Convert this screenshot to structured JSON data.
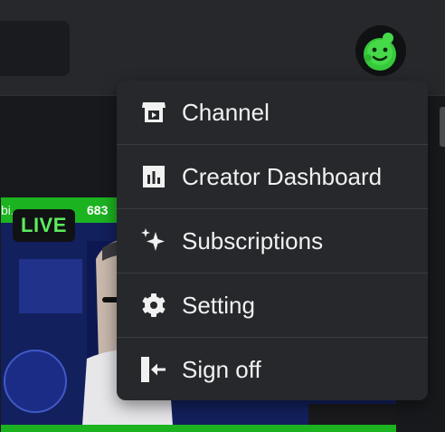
{
  "header": {
    "avatar_icon": "avatar-icon"
  },
  "stream": {
    "channel_name": "bi...",
    "viewer_count": "683",
    "live_badge": "LIVE",
    "accent_color": "#1cb321",
    "live_text_color": "#5ced5c"
  },
  "menu": {
    "items": [
      {
        "label": "Channel",
        "icon": "channel-icon"
      },
      {
        "label": "Creator Dashboard",
        "icon": "dashboard-icon"
      },
      {
        "label": "Subscriptions",
        "icon": "sparkle-icon"
      },
      {
        "label": "Setting",
        "icon": "gear-icon"
      },
      {
        "label": "Sign off",
        "icon": "sign-out-icon"
      }
    ]
  },
  "colors": {
    "background": "#18191c",
    "header": "#26282c",
    "menu_background": "#26282c",
    "menu_text": "#f1f1f1"
  }
}
